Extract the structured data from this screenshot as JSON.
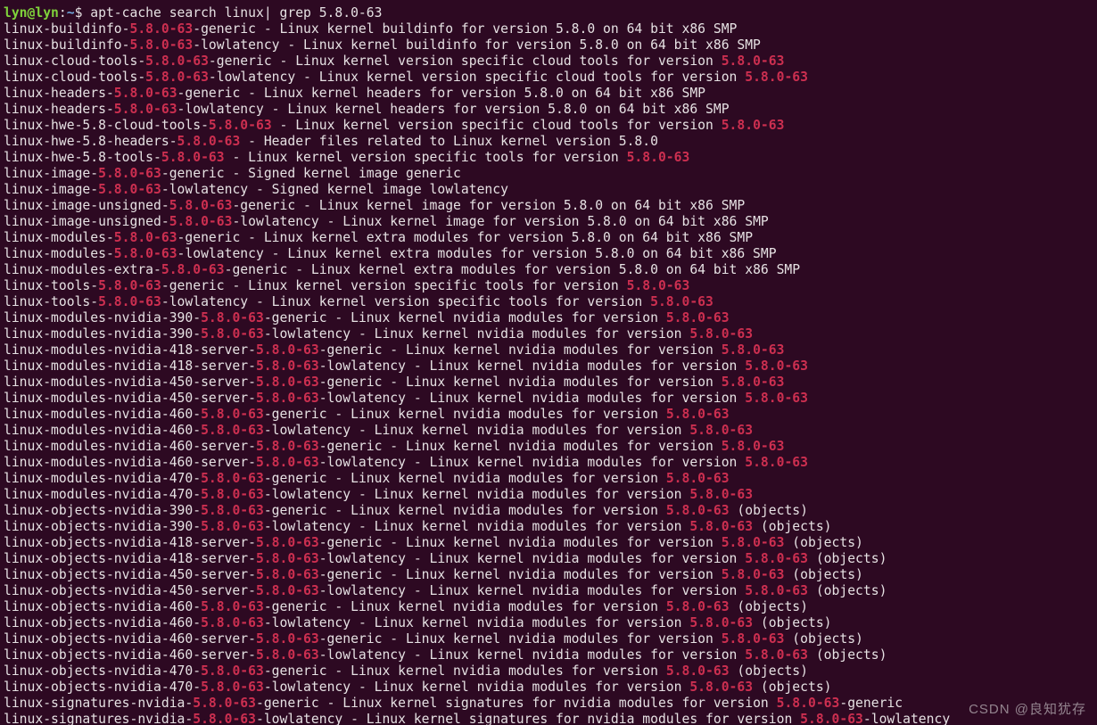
{
  "prompt": {
    "user": "lyn@lyn",
    "sep": ":",
    "path": "~",
    "dollar": "$ ",
    "command": "apt-cache search linux| grep 5.8.0-63"
  },
  "highlight": "5.8.0-63",
  "lines": [
    "linux-buildinfo-5.8.0-63-generic - Linux kernel buildinfo for version 5.8.0 on 64 bit x86 SMP",
    "linux-buildinfo-5.8.0-63-lowlatency - Linux kernel buildinfo for version 5.8.0 on 64 bit x86 SMP",
    "linux-cloud-tools-5.8.0-63-generic - Linux kernel version specific cloud tools for version 5.8.0-63",
    "linux-cloud-tools-5.8.0-63-lowlatency - Linux kernel version specific cloud tools for version 5.8.0-63",
    "linux-headers-5.8.0-63-generic - Linux kernel headers for version 5.8.0 on 64 bit x86 SMP",
    "linux-headers-5.8.0-63-lowlatency - Linux kernel headers for version 5.8.0 on 64 bit x86 SMP",
    "linux-hwe-5.8-cloud-tools-5.8.0-63 - Linux kernel version specific cloud tools for version 5.8.0-63",
    "linux-hwe-5.8-headers-5.8.0-63 - Header files related to Linux kernel version 5.8.0",
    "linux-hwe-5.8-tools-5.8.0-63 - Linux kernel version specific tools for version 5.8.0-63",
    "linux-image-5.8.0-63-generic - Signed kernel image generic",
    "linux-image-5.8.0-63-lowlatency - Signed kernel image lowlatency",
    "linux-image-unsigned-5.8.0-63-generic - Linux kernel image for version 5.8.0 on 64 bit x86 SMP",
    "linux-image-unsigned-5.8.0-63-lowlatency - Linux kernel image for version 5.8.0 on 64 bit x86 SMP",
    "linux-modules-5.8.0-63-generic - Linux kernel extra modules for version 5.8.0 on 64 bit x86 SMP",
    "linux-modules-5.8.0-63-lowlatency - Linux kernel extra modules for version 5.8.0 on 64 bit x86 SMP",
    "linux-modules-extra-5.8.0-63-generic - Linux kernel extra modules for version 5.8.0 on 64 bit x86 SMP",
    "linux-tools-5.8.0-63-generic - Linux kernel version specific tools for version 5.8.0-63",
    "linux-tools-5.8.0-63-lowlatency - Linux kernel version specific tools for version 5.8.0-63",
    "linux-modules-nvidia-390-5.8.0-63-generic - Linux kernel nvidia modules for version 5.8.0-63",
    "linux-modules-nvidia-390-5.8.0-63-lowlatency - Linux kernel nvidia modules for version 5.8.0-63",
    "linux-modules-nvidia-418-server-5.8.0-63-generic - Linux kernel nvidia modules for version 5.8.0-63",
    "linux-modules-nvidia-418-server-5.8.0-63-lowlatency - Linux kernel nvidia modules for version 5.8.0-63",
    "linux-modules-nvidia-450-server-5.8.0-63-generic - Linux kernel nvidia modules for version 5.8.0-63",
    "linux-modules-nvidia-450-server-5.8.0-63-lowlatency - Linux kernel nvidia modules for version 5.8.0-63",
    "linux-modules-nvidia-460-5.8.0-63-generic - Linux kernel nvidia modules for version 5.8.0-63",
    "linux-modules-nvidia-460-5.8.0-63-lowlatency - Linux kernel nvidia modules for version 5.8.0-63",
    "linux-modules-nvidia-460-server-5.8.0-63-generic - Linux kernel nvidia modules for version 5.8.0-63",
    "linux-modules-nvidia-460-server-5.8.0-63-lowlatency - Linux kernel nvidia modules for version 5.8.0-63",
    "linux-modules-nvidia-470-5.8.0-63-generic - Linux kernel nvidia modules for version 5.8.0-63",
    "linux-modules-nvidia-470-5.8.0-63-lowlatency - Linux kernel nvidia modules for version 5.8.0-63",
    "linux-objects-nvidia-390-5.8.0-63-generic - Linux kernel nvidia modules for version 5.8.0-63 (objects)",
    "linux-objects-nvidia-390-5.8.0-63-lowlatency - Linux kernel nvidia modules for version 5.8.0-63 (objects)",
    "linux-objects-nvidia-418-server-5.8.0-63-generic - Linux kernel nvidia modules for version 5.8.0-63 (objects)",
    "linux-objects-nvidia-418-server-5.8.0-63-lowlatency - Linux kernel nvidia modules for version 5.8.0-63 (objects)",
    "linux-objects-nvidia-450-server-5.8.0-63-generic - Linux kernel nvidia modules for version 5.8.0-63 (objects)",
    "linux-objects-nvidia-450-server-5.8.0-63-lowlatency - Linux kernel nvidia modules for version 5.8.0-63 (objects)",
    "linux-objects-nvidia-460-5.8.0-63-generic - Linux kernel nvidia modules for version 5.8.0-63 (objects)",
    "linux-objects-nvidia-460-5.8.0-63-lowlatency - Linux kernel nvidia modules for version 5.8.0-63 (objects)",
    "linux-objects-nvidia-460-server-5.8.0-63-generic - Linux kernel nvidia modules for version 5.8.0-63 (objects)",
    "linux-objects-nvidia-460-server-5.8.0-63-lowlatency - Linux kernel nvidia modules for version 5.8.0-63 (objects)",
    "linux-objects-nvidia-470-5.8.0-63-generic - Linux kernel nvidia modules for version 5.8.0-63 (objects)",
    "linux-objects-nvidia-470-5.8.0-63-lowlatency - Linux kernel nvidia modules for version 5.8.0-63 (objects)",
    "linux-signatures-nvidia-5.8.0-63-generic - Linux kernel signatures for nvidia modules for version 5.8.0-63-generic",
    "linux-signatures-nvidia-5.8.0-63-lowlatency - Linux kernel signatures for nvidia modules for version 5.8.0-63-lowlatency"
  ],
  "watermark": "CSDN @良知犹存"
}
